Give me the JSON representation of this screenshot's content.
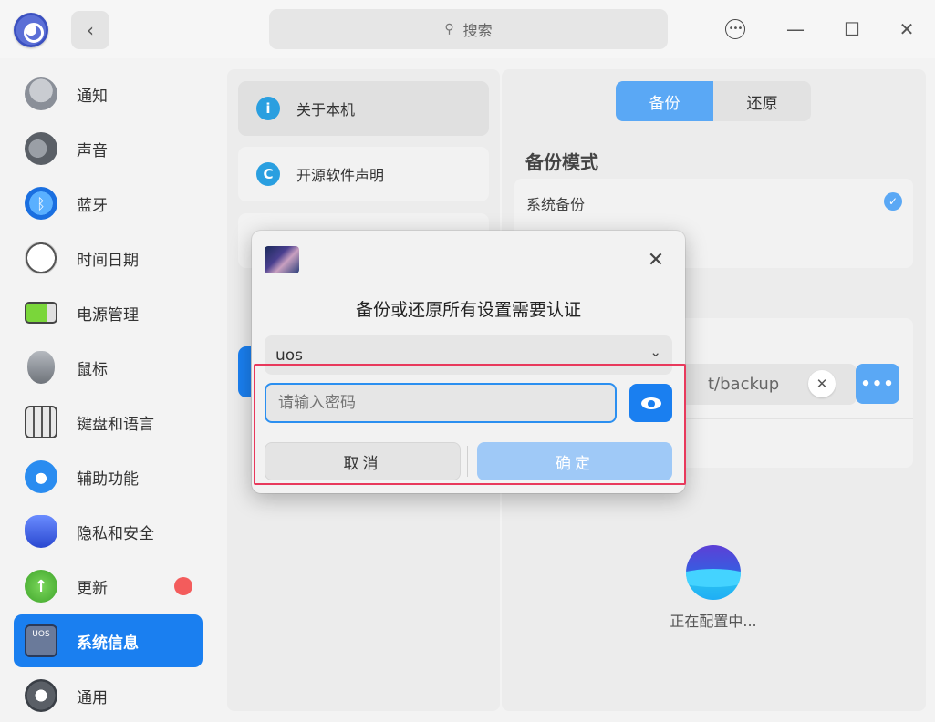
{
  "titlebar": {
    "back_icon": "chevron-left-icon",
    "search_icon": "search-icon",
    "search_label": "搜索",
    "menu_glyph": "•••",
    "minimize_glyph": "—",
    "maximize_glyph": "☐",
    "close_glyph": "✕"
  },
  "sidebar": {
    "items": [
      {
        "label": "通知",
        "icon": "bell-icon",
        "color": "#8a8f98"
      },
      {
        "label": "声音",
        "icon": "speaker-icon",
        "color": "#5a5f66"
      },
      {
        "label": "蓝牙",
        "icon": "bluetooth-icon",
        "color": "#2a8cf0"
      },
      {
        "label": "时间日期",
        "icon": "clock-icon",
        "color": "#d9d9d9"
      },
      {
        "label": "电源管理",
        "icon": "battery-icon",
        "color": "#6cc43a"
      },
      {
        "label": "鼠标",
        "icon": "mouse-icon",
        "color": "#7a7f86"
      },
      {
        "label": "键盘和语言",
        "icon": "keyboard-icon",
        "color": "#6e737a"
      },
      {
        "label": "辅助功能",
        "icon": "handshake-icon",
        "color": "#2a8cf0"
      },
      {
        "label": "隐私和安全",
        "icon": "shield-hand-icon",
        "color": "#3a5fe0"
      },
      {
        "label": "更新",
        "icon": "update-arrow-icon",
        "color": "#4fb93a"
      },
      {
        "label": "系统信息",
        "icon": "uos-monitor-icon",
        "color": "#5a6a8a"
      },
      {
        "label": "通用",
        "icon": "gear-icon",
        "color": "#5a5f66"
      }
    ],
    "update_badge_color": "#f35c5c"
  },
  "middle": {
    "items": [
      {
        "label": "关于本机",
        "icon": "info-icon",
        "glyph": "i"
      },
      {
        "label": "开源软件声明",
        "icon": "copyright-icon",
        "glyph": "C"
      }
    ]
  },
  "right": {
    "tabs": [
      "备份",
      "还原"
    ],
    "section_title": "备份模式",
    "system_backup_label": "系统备份",
    "check_glyph": "✓",
    "path_text": "t/backup",
    "clear_glyph": "✕",
    "more_glyph": "•••",
    "status_text": "正在配置中..."
  },
  "dialog": {
    "title": "备份或还原所有设置需要认证",
    "user_value": "uos",
    "chevron_glyph": "⌄",
    "password_placeholder": "请输入密码",
    "cancel_label": "取消",
    "ok_label": "确定",
    "close_glyph": "✕"
  },
  "colors": {
    "accent": "#1a7ff0",
    "accent_light": "#5aa8f5",
    "highlight_border": "#e8395c"
  }
}
